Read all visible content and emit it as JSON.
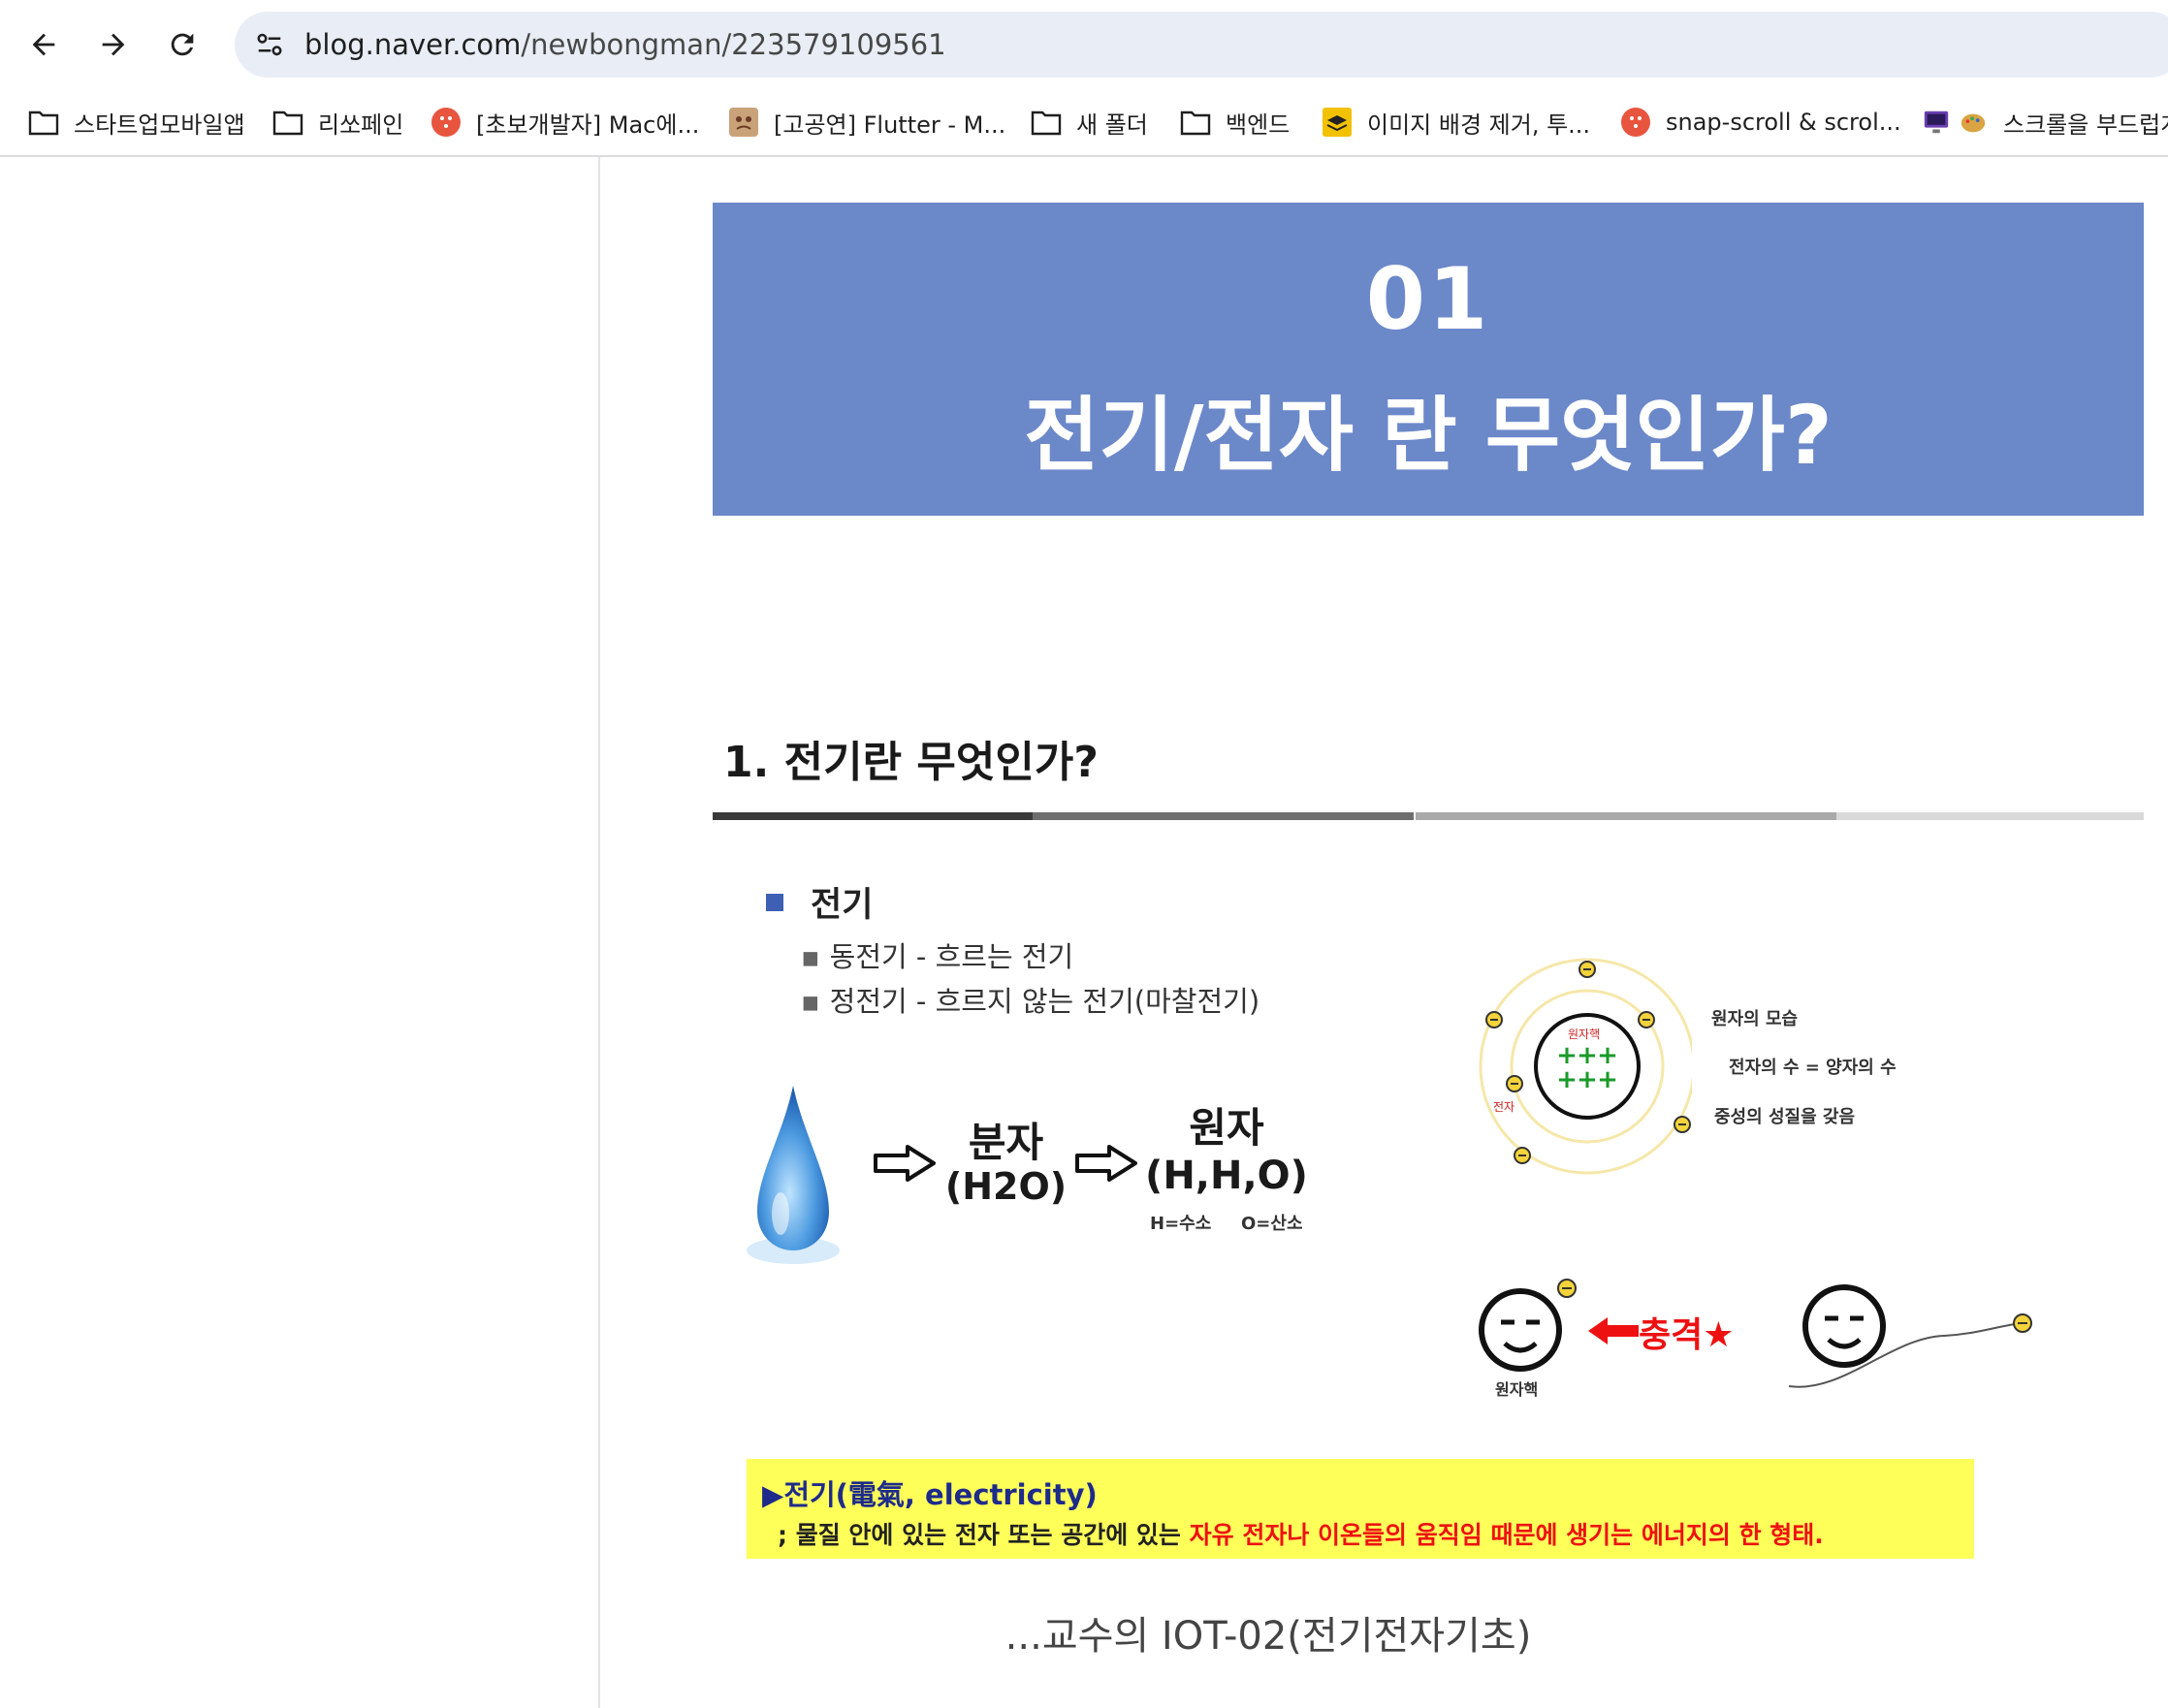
{
  "browser": {
    "url_host": "blog.naver.com",
    "url_path": "/newbongman/223579109561",
    "bookmarks": [
      {
        "label": "스타트업모바일앱",
        "icon": "folder-icon"
      },
      {
        "label": "리쏘페인",
        "icon": "folder-icon"
      },
      {
        "label": "[초보개발자] Mac에...",
        "icon": "site-icon"
      },
      {
        "label": "[고공연] Flutter - M...",
        "icon": "avatar-icon"
      },
      {
        "label": "새 폴더",
        "icon": "folder-icon"
      },
      {
        "label": "백엔드",
        "icon": "folder-icon"
      },
      {
        "label": "이미지 배경 제거, 투...",
        "icon": "site-icon"
      },
      {
        "label": "snap-scroll & scrol...",
        "icon": "site-icon"
      },
      {
        "label": "스크롤을 부드럽게...",
        "icon": "site-icon"
      }
    ]
  },
  "slide": {
    "banner_number": "01",
    "banner_title": "전기/전자 란 무엇인가?",
    "section_title": "1. 전기란 무엇인가?",
    "bullet_head": "전기",
    "sub_items": [
      "동전기 - 흐르는 전기",
      "정전기 - 흐르지 않는 전기(마찰전기)"
    ],
    "flow": {
      "molecule": "분자",
      "molecule_formula": "(H2O)",
      "atom": "원자",
      "atom_formula": "(H,H,O)",
      "legend_h": "H=수소",
      "legend_o": "O=산소"
    },
    "atom_diagram": {
      "nucleus_label": "원자핵",
      "electron_label": "전자",
      "notes": [
        "원자의 모습",
        "전자의 수 = 양자의 수",
        "중성의 성질을 갖음"
      ]
    },
    "impact": {
      "label": "충격★",
      "nucleus_label": "원자핵"
    },
    "definition": {
      "title": "전기(電氣, electricity)",
      "prefix": "; 물질 안에 있는 전자 또는 공간에 있는 ",
      "highlight": "자유 전자나 이온들의 움직임 때문에 생기는 에너지의 한 형태."
    }
  },
  "caption": "...교수의 IOT-02(전기전자기초)",
  "colors": {
    "banner": "#6b88c9",
    "bullet_square": "#3d5fb4",
    "highlight_box": "#ffff5a",
    "highlight_text": "#ee1111",
    "electron": "#f5d33a"
  }
}
